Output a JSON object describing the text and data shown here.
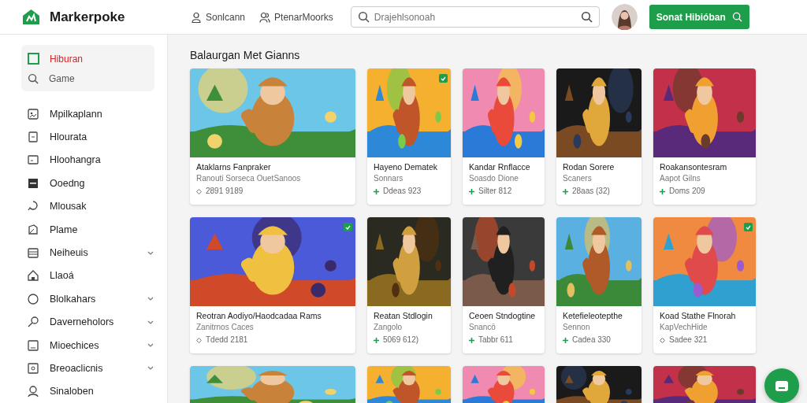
{
  "header": {
    "logo": "Markerpoke",
    "nav": [
      {
        "label": "Sonlcann"
      },
      {
        "label": "PtenarMoorks"
      }
    ],
    "search": {
      "placeholder": "Drajehlsonoah"
    },
    "action_button": "Sonat Hibióban"
  },
  "sidebar": {
    "top": [
      {
        "label": "Hiburan",
        "selected": true
      },
      {
        "label": "Game",
        "selected": false
      }
    ],
    "items": [
      {
        "label": "Mpilkaplann",
        "has_submenu": false
      },
      {
        "label": "Hlourata",
        "has_submenu": false
      },
      {
        "label": "Hloohangra",
        "has_submenu": false
      },
      {
        "label": "Ooedng",
        "has_submenu": false
      },
      {
        "label": "Mlousak",
        "has_submenu": false
      },
      {
        "label": "Plame",
        "has_submenu": false
      },
      {
        "label": "Neiheuis",
        "has_submenu": true
      },
      {
        "label": "Llaoá",
        "has_submenu": false
      },
      {
        "label": "Blolkahars",
        "has_submenu": true
      },
      {
        "label": "Daverneholors",
        "has_submenu": true
      },
      {
        "label": "Mioechices",
        "has_submenu": true
      },
      {
        "label": "Breoaclicnis",
        "has_submenu": true
      },
      {
        "label": "Sinaloben",
        "has_submenu": false
      }
    ]
  },
  "section_title": "Balaurgan Met Gianns",
  "cards": [
    {
      "title": "Ataklarns Fanpraker",
      "subtitle": "Ranouti Sorseca OuetSanoos",
      "meta": "2891 9189",
      "featured": false,
      "badge": false
    },
    {
      "title": "Hayeno Dematek",
      "subtitle": "Sonnars",
      "meta": "Ddeas 923",
      "featured": true,
      "badge": true
    },
    {
      "title": "Kandar Rnflacce",
      "subtitle": "Soasdo Dione",
      "meta": "Silter 812",
      "featured": true,
      "badge": false
    },
    {
      "title": "Rodan Sorere",
      "subtitle": "Scaners",
      "meta": "28aas (32)",
      "featured": true,
      "badge": false
    },
    {
      "title": "Roakansontesram",
      "subtitle": "Aapot Gilns",
      "meta": "Doms 209",
      "featured": true,
      "badge": false
    },
    {
      "title": "Reotran Aodiyo/Haodcadaa Rams",
      "subtitle": "Zanitrnos Caces",
      "meta": "Tdedd 2181",
      "featured": false,
      "badge": true
    },
    {
      "title": "Reatan Stdlogin",
      "subtitle": "Zangolo",
      "meta": "5069 612)",
      "featured": true,
      "badge": false
    },
    {
      "title": "Ceoen Stndogtine",
      "subtitle": "Snancö",
      "meta": "Tabbr 611",
      "featured": true,
      "badge": false
    },
    {
      "title": "Ketefieleotepthe",
      "subtitle": "Sennon",
      "meta": "Cadea 330",
      "featured": true,
      "badge": false
    },
    {
      "title": "Koad Stathe Flnorah",
      "subtitle": "KapVechHide",
      "meta": "Sadee 321",
      "featured": false,
      "badge": true
    },
    {
      "kind": "picture"
    },
    {
      "kind": "picture"
    },
    {
      "kind": "picture"
    },
    {
      "kind": "picture"
    },
    {
      "kind": "picture"
    }
  ]
}
